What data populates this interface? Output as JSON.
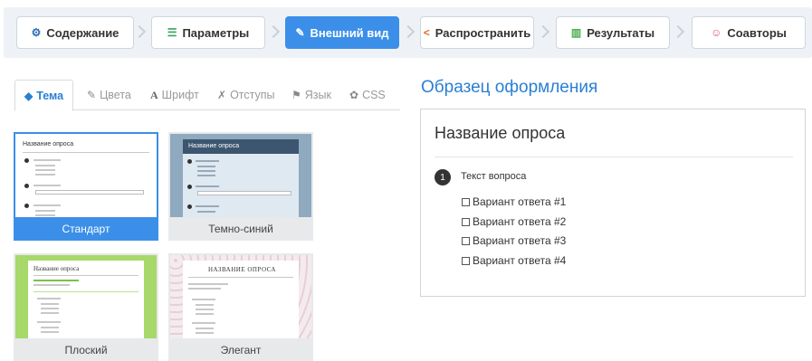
{
  "steps": [
    {
      "label": "Содержание",
      "icon": "sitemap-icon",
      "glyph": "⚙",
      "active": false
    },
    {
      "label": "Параметры",
      "icon": "sliders-icon",
      "glyph": "☰",
      "active": false
    },
    {
      "label": "Внешний вид",
      "icon": "brush-icon",
      "glyph": "✎",
      "active": true
    },
    {
      "label": "Распространить",
      "icon": "share-icon",
      "glyph": "<",
      "active": false
    },
    {
      "label": "Результаты",
      "icon": "bar-chart-icon",
      "glyph": "▥",
      "active": false
    },
    {
      "label": "Соавторы",
      "icon": "users-icon",
      "glyph": "☺",
      "active": false
    }
  ],
  "tabs": [
    {
      "label": "Тема",
      "icon": "cube-icon",
      "glyph": "◆",
      "active": true
    },
    {
      "label": "Цвета",
      "icon": "brush-icon",
      "glyph": "✎",
      "active": false
    },
    {
      "label": "Шрифт",
      "icon": "font-icon",
      "glyph": "A",
      "active": false
    },
    {
      "label": "Отступы",
      "icon": "magic-icon",
      "glyph": "✗",
      "active": false
    },
    {
      "label": "Язык",
      "icon": "flag-icon",
      "glyph": "⚑",
      "active": false
    },
    {
      "label": "CSS",
      "icon": "gear-icon",
      "glyph": "✿",
      "active": false
    }
  ],
  "themes": [
    {
      "label": "Стандарт",
      "selected": true
    },
    {
      "label": "Темно-синий",
      "selected": false
    },
    {
      "label": "Плоский",
      "selected": false
    },
    {
      "label": "Элегант",
      "selected": false
    }
  ],
  "thumbs": {
    "standard_title": "Название опроса",
    "darkblue_title": "Название опроса",
    "flat_title": "Название опроса",
    "elegant_title": "НАЗВАНИЕ ОПРОСА"
  },
  "sample": {
    "heading": "Образец оформления",
    "survey_title": "Название опроса",
    "question_number": "1",
    "question_text": "Текст вопроса",
    "options": [
      "Вариант ответа #1",
      "Вариант ответа #2",
      "Вариант ответа #3",
      "Вариант ответа #4"
    ]
  },
  "colors": {
    "accent": "#3b8fe8",
    "link": "#2a7fd4",
    "flat_green": "#a6d86a",
    "dark_blue": "#3d5670"
  }
}
